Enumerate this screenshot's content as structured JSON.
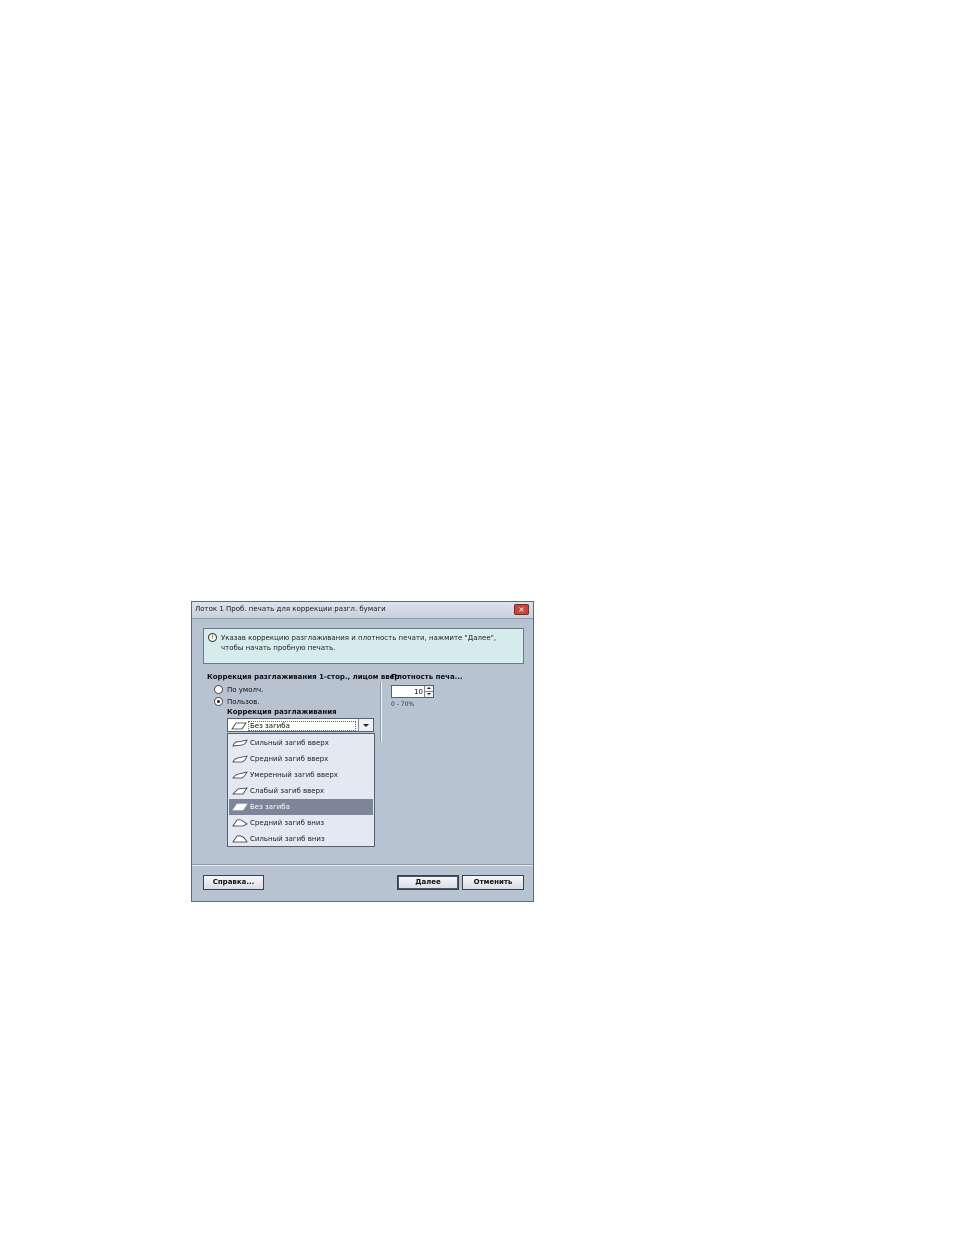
{
  "dialog": {
    "title": "Лоток 1 Проб. печать для коррекции разгл. бумаги",
    "close_label": "×",
    "info": {
      "icon": "info-icon",
      "line1": "Указав коррекцию разглаживания и плотность печати, нажмите \"Далее\",",
      "line2": "чтобы начать пробную печать."
    },
    "correction_group": {
      "label": "Коррекция разглаживания 1-стор., лицом ввер",
      "options": [
        {
          "label": "По умолч.",
          "selected": false
        },
        {
          "label": "Пользов.",
          "selected": true
        }
      ],
      "sub_label": "Коррекция разглаживания",
      "combo_value": "Без загиба",
      "dropdown_items": [
        {
          "label": "Сильный загиб вверх",
          "icon": "curl-up-strong-icon",
          "selected": false
        },
        {
          "label": "Средний загиб вверх",
          "icon": "curl-up-medium-icon",
          "selected": false
        },
        {
          "label": "Умеренный загиб вверх",
          "icon": "curl-up-moderate-icon",
          "selected": false
        },
        {
          "label": "Слабый загиб вверх",
          "icon": "curl-up-weak-icon",
          "selected": false
        },
        {
          "label": "Без загиба",
          "icon": "no-curl-icon",
          "selected": true
        },
        {
          "label": "Средний загиб вниз",
          "icon": "curl-down-medium-icon",
          "selected": false
        },
        {
          "label": "Сильный загиб вниз",
          "icon": "curl-down-strong-icon",
          "selected": false
        }
      ]
    },
    "density": {
      "label": "Плотность печа...",
      "value": "10",
      "range": "0 - 70%"
    },
    "buttons": {
      "help": "Справка...",
      "next": "Далее",
      "cancel": "Отменить"
    },
    "colors": {
      "dialog_bg": "#b8c3d2",
      "info_bg": "#d6ecec",
      "dropdown_bg": "#e4e8f3",
      "selected_bg": "#7d8598",
      "close": "#c9463d"
    }
  }
}
